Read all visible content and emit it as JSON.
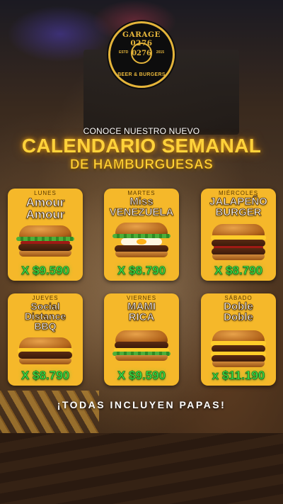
{
  "logo": {
    "top_text": "GARAGE 0276",
    "center_text": "0276",
    "estd": "ESTD",
    "year": "2015",
    "bottom_text": "BEER & BURGERS"
  },
  "intro": "CONOCE NUESTRO NUEVO",
  "title": "CALENDARIO SEMANAL",
  "subtitle": "DE HAMBURGUESAS",
  "cards": [
    {
      "day": "LUNES",
      "name_line1": "Amour",
      "name_line2": "Amour",
      "name_line3": "",
      "price": "X $9.590"
    },
    {
      "day": "MARTES",
      "name_line1": "Miss",
      "name_line2": "VENEZUELA",
      "name_line3": "",
      "price": "X $8.790"
    },
    {
      "day": "MIÉRCOLES",
      "name_line1": "JALAPEÑO",
      "name_line2": "BURGER",
      "name_line3": "",
      "price": "X $8.790"
    },
    {
      "day": "JUEVES",
      "name_line1": "Social",
      "name_line2": "Distance",
      "name_line3": "BBQ",
      "price": "X $8.790"
    },
    {
      "day": "VIERNES",
      "name_line1": "MAMI",
      "name_line2": "RICA",
      "name_line3": "",
      "price": "X $9.590"
    },
    {
      "day": "SÁBADO",
      "name_line1": "Doble",
      "name_line2": "Doble",
      "name_line3": "",
      "price": "x $11.190"
    }
  ],
  "footer": "¡TODAS INCLUYEN PAPAS!",
  "colors": {
    "card_bg": "#f5b82a",
    "title": "#ffd23a",
    "price": "#3ee04a",
    "logo_gold": "#e4b43a"
  }
}
